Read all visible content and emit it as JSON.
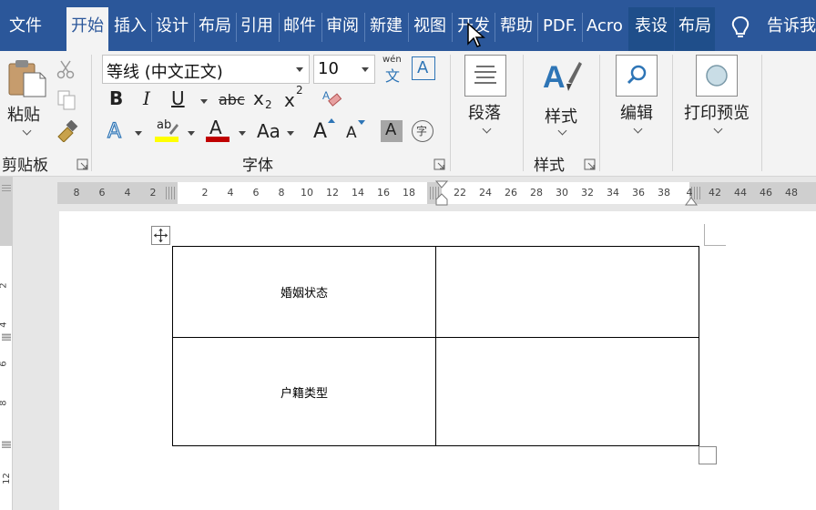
{
  "tabs": [
    {
      "label": "文件",
      "active": false
    },
    {
      "label": "开始",
      "active": true
    },
    {
      "label": "插入",
      "active": false
    },
    {
      "label": "设计",
      "active": false
    },
    {
      "label": "布局",
      "active": false
    },
    {
      "label": "引用",
      "active": false
    },
    {
      "label": "邮件",
      "active": false
    },
    {
      "label": "审阅",
      "active": false
    },
    {
      "label": "新建",
      "active": false
    },
    {
      "label": "视图",
      "active": false
    },
    {
      "label": "开发",
      "active": false
    },
    {
      "label": "帮助",
      "active": false
    },
    {
      "label": "PDF.",
      "active": false
    },
    {
      "label": "Acro",
      "active": false
    },
    {
      "label": "表设",
      "active": false
    },
    {
      "label": "布局",
      "active": false
    }
  ],
  "tell_me": {
    "label": "告诉我"
  },
  "ribbon": {
    "clipboard": {
      "paste_label": "粘贴",
      "group_label": "剪贴板"
    },
    "font": {
      "font_name": "等线 (中文正文)",
      "font_size": "10",
      "wen_top": "wén",
      "wen_bottom": "文",
      "bold": "B",
      "italic": "I",
      "underline": "U",
      "strike": "abc",
      "sub": "x",
      "sub_small": "2",
      "sup": "x",
      "sup_small": "2",
      "highlight": "ab",
      "color": "A",
      "case": "Aa",
      "grow": "A",
      "shrink": "A",
      "shade": "A",
      "phonetic": "字",
      "border_a": "A",
      "group_label": "字体"
    },
    "paragraph": {
      "label": "段落"
    },
    "styles": {
      "label": "样式",
      "group_label": "样式"
    },
    "editing": {
      "label": "编辑"
    },
    "print": {
      "label": "打印预览"
    }
  },
  "ruler": {
    "h_left_numbers": [
      "8",
      "6",
      "4",
      "2"
    ],
    "h_numbers": [
      "2",
      "4",
      "6",
      "8",
      "10",
      "12",
      "14",
      "16",
      "18",
      "22",
      "24",
      "26",
      "28",
      "30",
      "32",
      "34",
      "36",
      "38",
      "4",
      "42",
      "44",
      "46",
      "48"
    ],
    "v_numbers": [
      "2",
      "4",
      "6",
      "8",
      "12"
    ]
  },
  "table": {
    "rows": [
      [
        "婚姻状态",
        ""
      ],
      [
        "户籍类型",
        ""
      ]
    ]
  },
  "colors": {
    "title_bar": "#2b579a",
    "ribbon_bg": "#f3f3f3",
    "font_color_red": "#c00000",
    "highlight_yellow": "#ffff00",
    "text_effect_blue": "#2e75b6"
  }
}
